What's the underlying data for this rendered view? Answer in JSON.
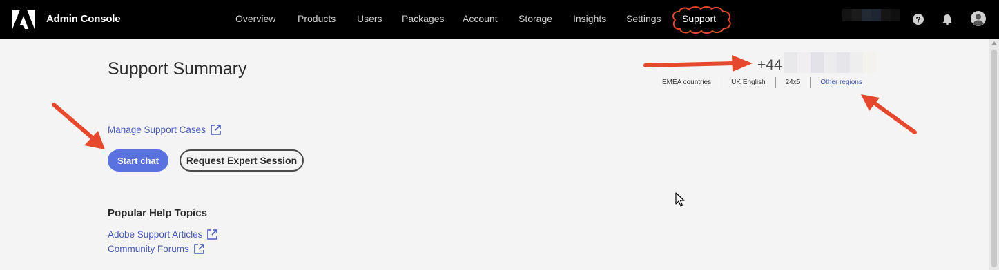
{
  "header": {
    "app_title": "Admin Console",
    "nav": [
      {
        "label": "Overview",
        "active": false
      },
      {
        "label": "Products",
        "active": false
      },
      {
        "label": "Users",
        "active": false
      },
      {
        "label": "Packages",
        "active": false
      },
      {
        "label": "Account",
        "active": false
      },
      {
        "label": "Storage",
        "active": false
      },
      {
        "label": "Insights",
        "active": false
      },
      {
        "label": "Settings",
        "active": false
      },
      {
        "label": "Support",
        "active": true
      }
    ],
    "icons": [
      "adobe-logo-icon",
      "help-icon",
      "bell-icon",
      "user-avatar-icon"
    ]
  },
  "main": {
    "title": "Support Summary",
    "phone_prefix": "+44",
    "regions": [
      "EMEA countries",
      "UK English",
      "24x5"
    ],
    "other_regions_label": "Other regions",
    "manage_cases_label": "Manage Support Cases",
    "start_chat_label": "Start chat",
    "request_session_label": "Request Expert Session",
    "help_heading": "Popular Help Topics",
    "help_links": [
      "Adobe Support Articles",
      "Community Forums"
    ]
  },
  "colors": {
    "accent": "#5a71e0",
    "link": "#4b5db8",
    "annotation": "#e5482c",
    "topbar": "#000000"
  }
}
